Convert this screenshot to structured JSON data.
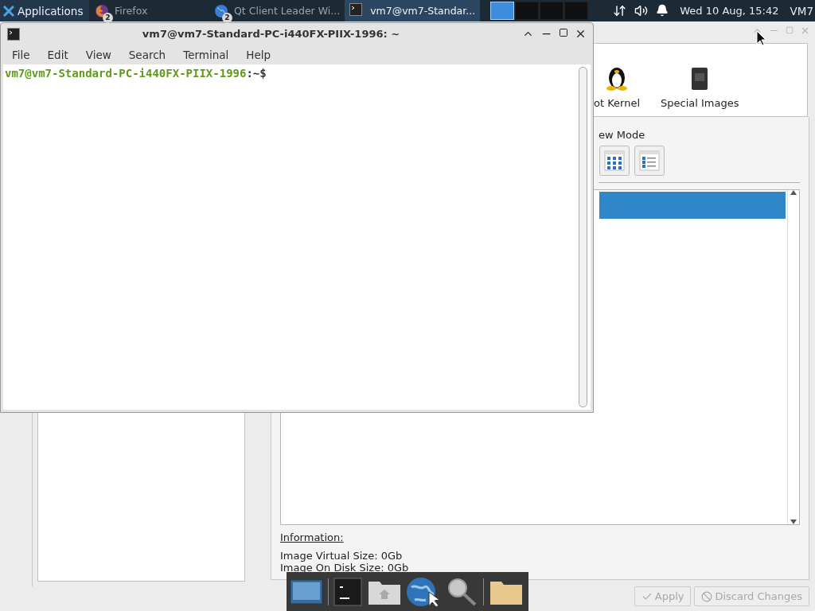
{
  "panel": {
    "app_menu": "Applications",
    "tasks": [
      {
        "label": "Firefox",
        "badge": "2",
        "kind": "firefox",
        "selected": false
      },
      {
        "label": "Qt Client Leader Wi...",
        "badge": "2",
        "kind": "qt",
        "selected": false
      },
      {
        "label": "vm7@vm7-Standar...",
        "kind": "terminal",
        "selected": true
      }
    ],
    "workspaces": [
      {
        "selected": true
      },
      {
        "selected": false
      },
      {
        "selected": false
      },
      {
        "selected": false
      }
    ],
    "clock": "Wed 10 Aug, 15:42",
    "user": "VM7"
  },
  "terminal": {
    "title": "vm7@vm7-Standard-PC-i440FX-PIIX-1996: ~",
    "menu": [
      "File",
      "Edit",
      "View",
      "Search",
      "Terminal",
      "Help"
    ],
    "prompt_user": "vm7@vm7-Standard-PC-i440FX-PIIX-1996",
    "prompt_path": ":~$"
  },
  "back_window": {
    "categories": [
      {
        "label": "ot Kernel",
        "kind": "tux"
      },
      {
        "label": "Special Images",
        "kind": "chip"
      }
    ],
    "view_mode_label": "ew Mode",
    "view_modes": [
      {
        "kind": "icons"
      },
      {
        "kind": "list"
      }
    ],
    "rows": [
      {
        "selected": true
      }
    ],
    "information_label": "Information:",
    "info": [
      "Image Virtual Size: 0Gb",
      "Image On Disk Size: 0Gb"
    ],
    "buttons": [
      {
        "label": "Apply",
        "kind": "apply",
        "disabled": true
      },
      {
        "label": "Discard Changes",
        "kind": "discard",
        "disabled": true
      }
    ]
  },
  "dock": {
    "items": [
      {
        "kind": "desktop"
      },
      {
        "kind": "separator"
      },
      {
        "kind": "terminal"
      },
      {
        "kind": "home"
      },
      {
        "kind": "browser"
      },
      {
        "kind": "search"
      },
      {
        "kind": "separator"
      },
      {
        "kind": "folder"
      }
    ]
  }
}
